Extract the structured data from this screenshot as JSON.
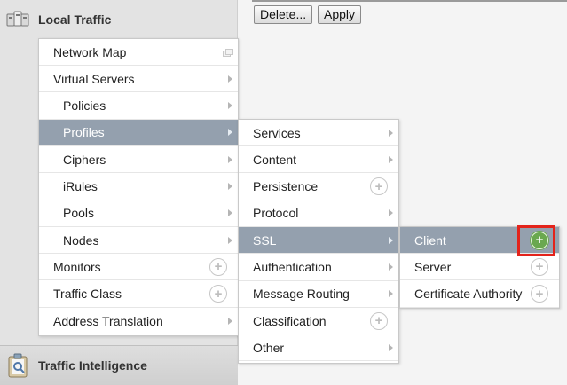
{
  "sidebar": {
    "local_traffic": {
      "title": "Local Traffic",
      "icon": "local-traffic-icon"
    },
    "traffic_intelligence": {
      "title": "Traffic Intelligence",
      "icon": "clipboard-icon"
    }
  },
  "toolbar": {
    "delete_label": "Delete...",
    "apply_label": "Apply"
  },
  "menu_level1": {
    "items": [
      {
        "label": "Network Map",
        "suffix": "network-map-icon"
      },
      {
        "label": "Virtual Servers",
        "suffix": "arrow"
      },
      {
        "label": "Policies",
        "suffix": "arrow"
      },
      {
        "label": "Profiles",
        "suffix": "arrow",
        "active": true
      },
      {
        "label": "Ciphers",
        "suffix": "arrow"
      },
      {
        "label": "iRules",
        "suffix": "arrow"
      },
      {
        "label": "Pools",
        "suffix": "arrow"
      },
      {
        "label": "Nodes",
        "suffix": "arrow"
      },
      {
        "label": "Monitors",
        "suffix": "plus"
      },
      {
        "label": "Traffic Class",
        "suffix": "plus"
      },
      {
        "label": "Address Translation",
        "suffix": "arrow"
      }
    ]
  },
  "menu_level2": {
    "items": [
      {
        "label": "Services",
        "suffix": "arrow"
      },
      {
        "label": "Content",
        "suffix": "arrow"
      },
      {
        "label": "Persistence",
        "suffix": "plus"
      },
      {
        "label": "Protocol",
        "suffix": "arrow"
      },
      {
        "label": "SSL",
        "suffix": "arrow",
        "active": true
      },
      {
        "label": "Authentication",
        "suffix": "arrow"
      },
      {
        "label": "Message Routing",
        "suffix": "arrow"
      },
      {
        "label": "Classification",
        "suffix": "plus"
      },
      {
        "label": "Other",
        "suffix": "arrow"
      }
    ]
  },
  "menu_level3": {
    "items": [
      {
        "label": "Client",
        "suffix": "plus-green",
        "active": true
      },
      {
        "label": "Server",
        "suffix": "plus"
      },
      {
        "label": "Certificate Authority",
        "suffix": "plus"
      }
    ]
  },
  "colors": {
    "active_bg": "#94a0ae",
    "highlight": "#e3231b",
    "add_green": "#6aa84f"
  }
}
